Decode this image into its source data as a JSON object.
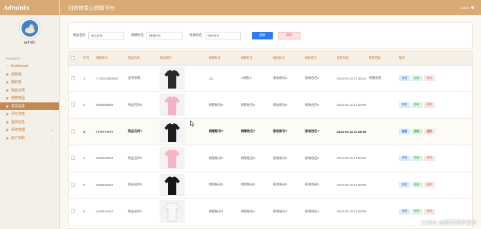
{
  "brand": "Admints",
  "header": {
    "title": "旧衣物爱心捐赠平台",
    "user": "admin"
  },
  "sidebar": {
    "user_name": "admin",
    "nav_title": "Navigation",
    "items": [
      {
        "label": "Dashboard",
        "icon": "home-icon"
      },
      {
        "label": "捐赠者",
        "icon": "grid-icon"
      },
      {
        "label": "接收者",
        "icon": "grid-icon"
      },
      {
        "label": "物品分类",
        "icon": "grid-icon"
      },
      {
        "label": "捐赠物品",
        "icon": "grid-icon"
      },
      {
        "label": "发货信息",
        "icon": "grid-icon",
        "active": true
      },
      {
        "label": "评价信息",
        "icon": "grid-icon"
      },
      {
        "label": "退货信息",
        "icon": "grid-icon"
      },
      {
        "label": "系统管理",
        "icon": "grid-icon",
        "caret": "⌄"
      },
      {
        "label": "用户资料",
        "icon": "grid-icon",
        "caret": "⌄"
      }
    ]
  },
  "search": {
    "field1_label": "物品名称",
    "field1_placeholder": "物品名称",
    "field2_label": "捐赠姓名",
    "field2_placeholder": "捐赠姓名",
    "field3_label": "接收姓名",
    "field3_placeholder": "接收姓名",
    "search_button": "搜索",
    "delete_button": "删除"
  },
  "table": {
    "columns": [
      "",
      "序号",
      "捐赠单号",
      "物品名称",
      "物品图片",
      "捐赠账号",
      "捐赠姓名",
      "接收账号",
      "接收姓名",
      "发货时间",
      "审核回复",
      "操作"
    ],
    "ops": {
      "view": "查看",
      "edit": "修改",
      "delete": "删除"
    },
    "rows": [
      {
        "no": "1",
        "order": "1710322504067",
        "item": "送衣捐赠",
        "shirt_color": "#2b2b2b",
        "donor_acc": "111",
        "donor_name": "A捐赠人",
        "recv_acc": "接收账号2",
        "recv_name": "接收姓名2",
        "time": "2024-03-13 17:35:04",
        "reply": "捐赠反馈"
      },
      {
        "no": "2",
        "order": "8888888888",
        "item": "物品名称8",
        "shirt_color": "#f2b4c4",
        "donor_acc": "捐赠账号8",
        "donor_name": "捐赠姓名8",
        "recv_acc": "接收账号8",
        "recv_name": "接收姓名8",
        "time": "2024-03-13 17:28:09",
        "reply": ""
      },
      {
        "no": "3",
        "order": "7777777777",
        "item": "物品名称7",
        "shirt_color": "#1e1e1e",
        "donor_acc": "捐赠账号7",
        "donor_name": "捐赠姓名7",
        "recv_acc": "接收账号7",
        "recv_name": "接收姓名7",
        "time": "2024-03-13 17:28:09",
        "reply": "",
        "highlight": true
      },
      {
        "no": "4",
        "order": "6666666666",
        "item": "物品名称6",
        "shirt_color": "#f4b6c6",
        "donor_acc": "捐赠账号6",
        "donor_name": "捐赠姓名6",
        "recv_acc": "接收账号6",
        "recv_name": "接收姓名6",
        "time": "2024-03-13 17:28:09",
        "reply": ""
      },
      {
        "no": "5",
        "order": "5555555555",
        "item": "物品名称5",
        "shirt_color": "#161616",
        "donor_acc": "捐赠账号5",
        "donor_name": "捐赠姓名5",
        "recv_acc": "接收账号5",
        "recv_name": "接收姓名5",
        "time": "2024-03-13 17:28:09",
        "reply": ""
      },
      {
        "no": "6",
        "order": "4444444444",
        "item": "物品名称4",
        "shirt_color": "#f7f7f7",
        "donor_acc": "捐赠账号4",
        "donor_name": "捐赠姓名4",
        "recv_acc": "接收账号4",
        "recv_name": "接收姓名4",
        "time": "2024-03-13 17:28:09",
        "reply": ""
      }
    ]
  },
  "watermark": "CSDN @酷可程序设计"
}
